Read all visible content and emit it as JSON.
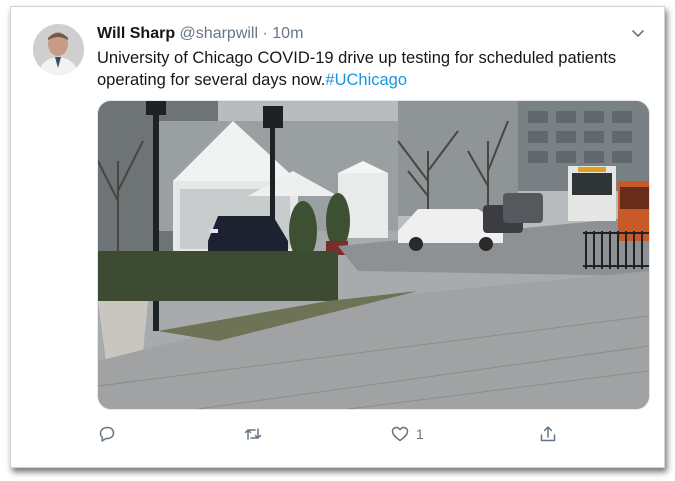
{
  "tweet": {
    "author_name": "Will Sharp",
    "author_handle": "@sharpwill",
    "separator": "·",
    "timestamp": "10m",
    "text": "University of Chicago COVID-19 drive up testing for scheduled patients operating for several days now.",
    "hashtag": "#UChicago",
    "hashtag_color": "#1b95e0",
    "avatar": "user-avatar-photo",
    "media": "photo-drive-up-testing-site"
  },
  "actions": {
    "reply": {
      "icon": "reply-icon",
      "count": ""
    },
    "retweet": {
      "icon": "retweet-icon",
      "count": ""
    },
    "like": {
      "icon": "heart-icon",
      "count": "1"
    },
    "share": {
      "icon": "share-icon",
      "count": ""
    }
  },
  "colors": {
    "text": "#14171a",
    "secondary": "#657786",
    "link": "#1b95e0"
  }
}
